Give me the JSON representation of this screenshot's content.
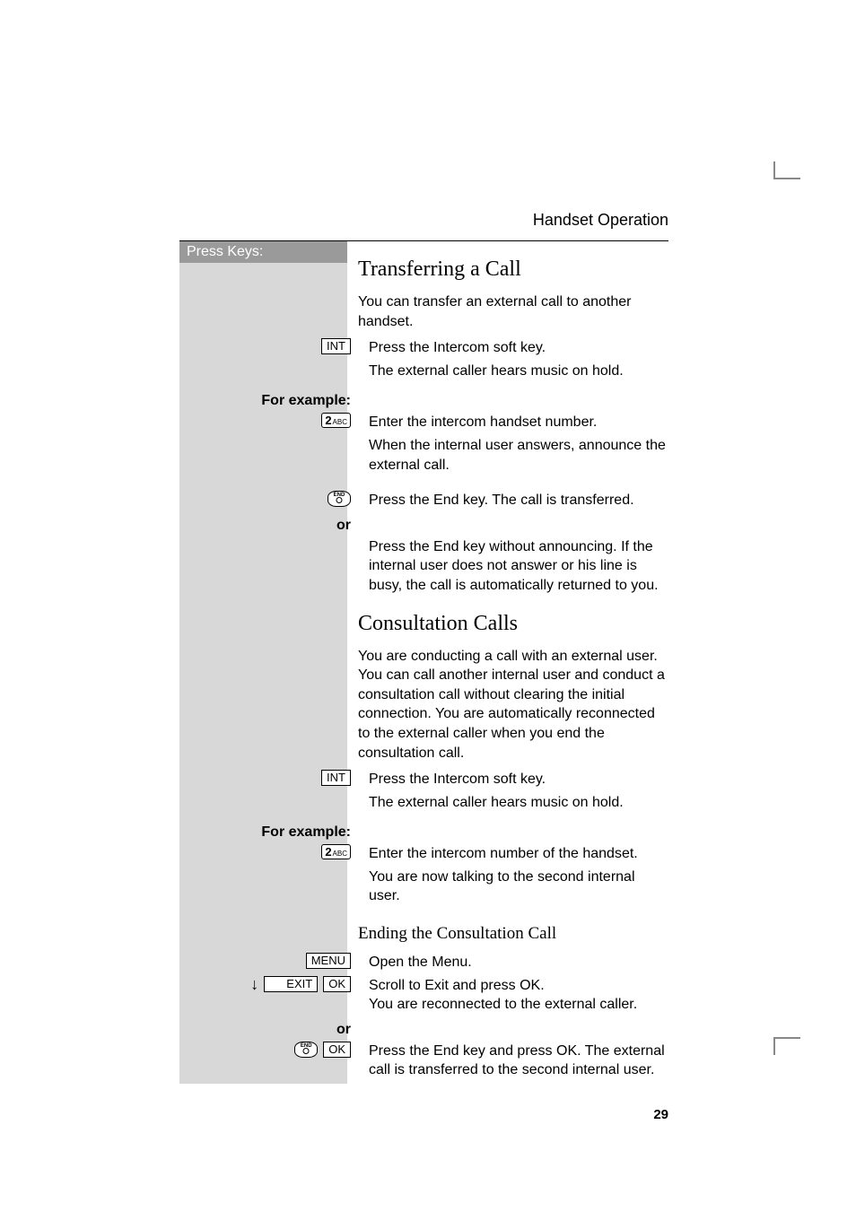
{
  "header": {
    "section": "Handset Operation"
  },
  "sidebar": {
    "title": "Press Keys:"
  },
  "keys": {
    "int": "INT",
    "menu": "MENU",
    "ok": "OK",
    "exit": "EXIT",
    "two_main": "2",
    "two_sub": "ABC"
  },
  "labels": {
    "for_example": "For example:",
    "or": "or",
    "arrow_down": "↓"
  },
  "sectionA": {
    "title": "Transferring a Call",
    "intro": "You can transfer an external call to another handset.",
    "step_int": "Press the Intercom soft key.",
    "hold_note": "The external caller hears music on hold.",
    "step_two": "Enter the intercom handset number.",
    "announce": "When the internal user answers, announce the external call.",
    "end_transfer": "Press the End key. The call is transferred.",
    "end_alt": "Press the End key without announcing. If the internal user does not answer or his line is busy, the call is automatically returned to you."
  },
  "sectionB": {
    "title": "Consultation Calls",
    "intro": "You are conducting a call with an external user. You can call another internal user and conduct a consultation call without clearing the initial connection. You are automatically reconnected to the external caller when you end the consultation call.",
    "step_int": "Press the Intercom soft key.",
    "hold_note": "The external caller hears music on hold.",
    "step_two": "Enter the intercom number of the handset.",
    "talking": "You are now talking to the second internal user."
  },
  "sectionC": {
    "title": "Ending the Consultation Call",
    "step_menu": "Open the Menu.",
    "step_exit_ok": "Scroll to Exit and press OK.\nYou are reconnected to the external caller.",
    "step_end_ok": "Press the End key and press OK. The external call is transferred to the second internal user."
  },
  "page_number": "29"
}
